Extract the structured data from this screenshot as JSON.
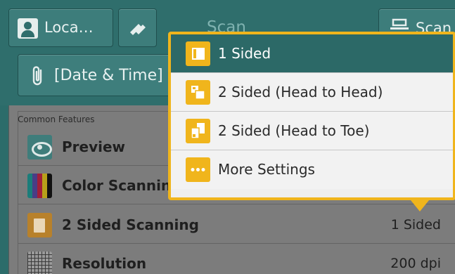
{
  "header": {
    "login_label": "Loca…",
    "title": "Scan",
    "scan_label": "Scan"
  },
  "filename_bar": {
    "label": "[Date & Time]"
  },
  "features": {
    "section_label": "Common Features",
    "rows": [
      {
        "label": "Preview",
        "value": ""
      },
      {
        "label": "Color Scanning",
        "value": ""
      },
      {
        "label": "2 Sided Scanning",
        "value": "1 Sided"
      },
      {
        "label": "Resolution",
        "value": "200 dpi"
      }
    ]
  },
  "popup": {
    "options": [
      {
        "label": "1 Sided",
        "selected": true,
        "icon": "one-sided-icon"
      },
      {
        "label": "2 Sided (Head to Head)",
        "selected": false,
        "icon": "two-sided-head-to-head-icon"
      },
      {
        "label": "2 Sided (Head to Toe)",
        "selected": false,
        "icon": "two-sided-head-to-toe-icon"
      },
      {
        "label": "More Settings",
        "selected": false,
        "icon": "more-icon"
      }
    ]
  },
  "colors": {
    "header_teal": "#2f6e6c",
    "accent_yellow": "#f0b51c",
    "selected_teal": "#2c6967"
  }
}
